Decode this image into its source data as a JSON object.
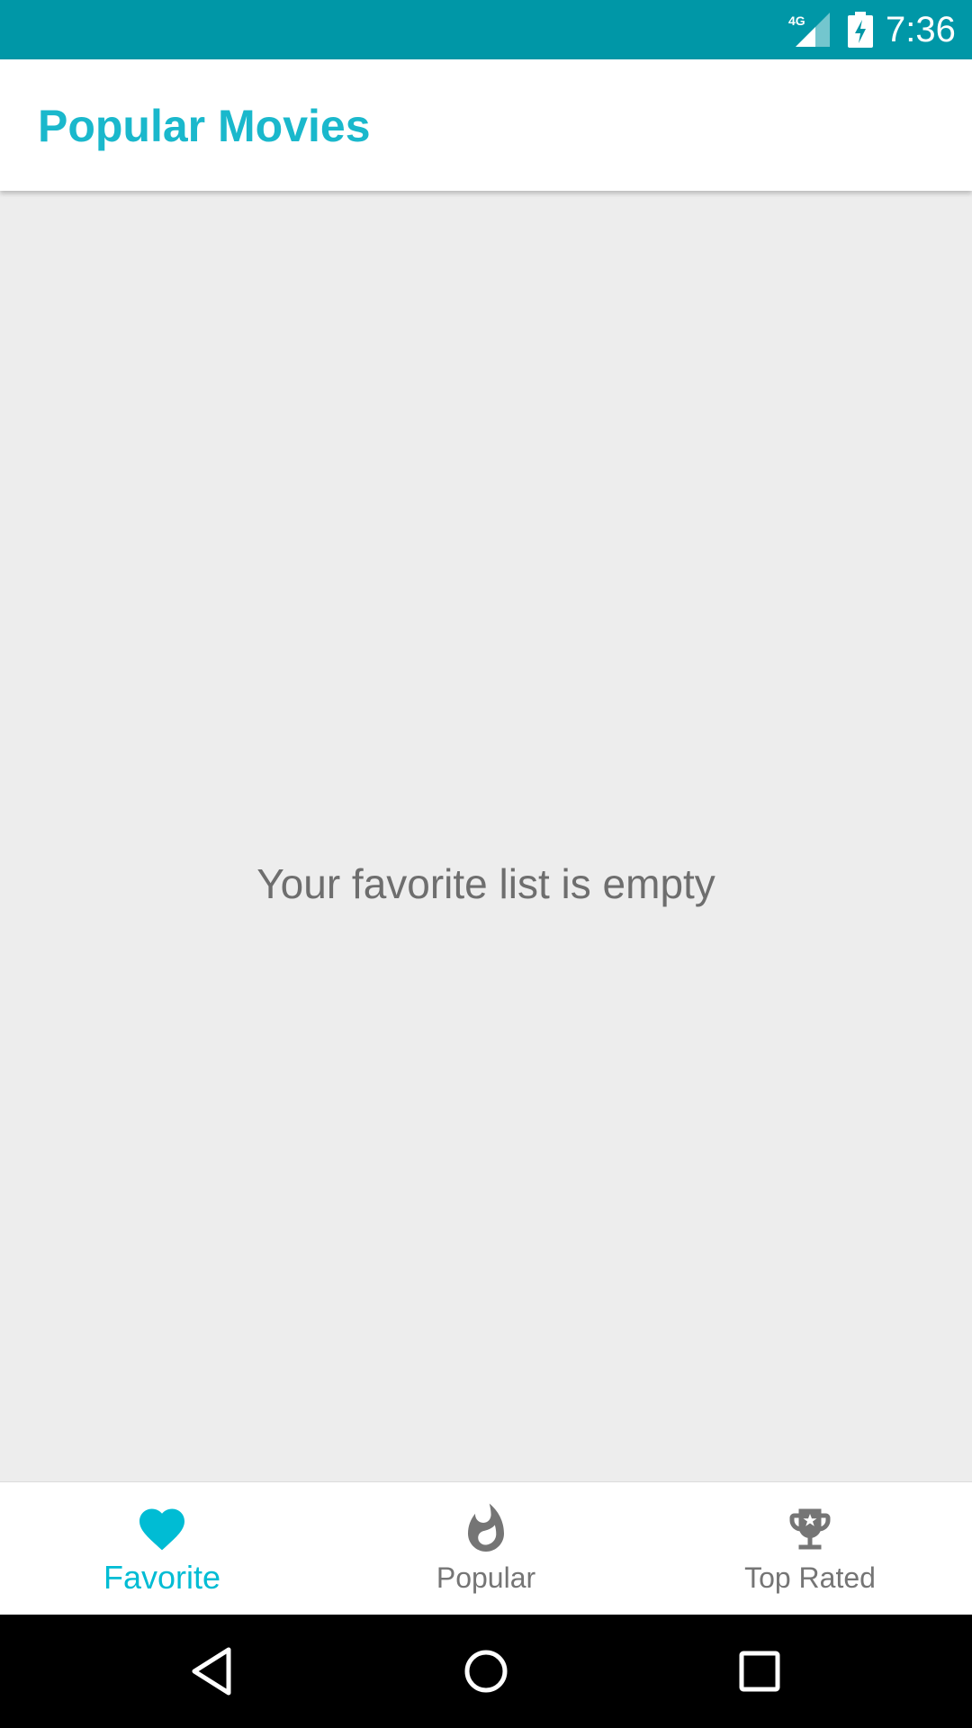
{
  "status_bar": {
    "time": "7:36",
    "network_label": "4G",
    "background_color": "#0097a7",
    "icons": [
      "signal-4g-icon",
      "battery-charging-icon"
    ]
  },
  "app_bar": {
    "title": "Popular Movies",
    "title_color": "#1ab8cc"
  },
  "content": {
    "empty_message": "Your favorite list is empty"
  },
  "bottom_nav": {
    "active_color": "#00bcd4",
    "inactive_color": "#757575",
    "items": [
      {
        "label": "Favorite",
        "icon": "heart-icon",
        "active": true
      },
      {
        "label": "Popular",
        "icon": "flame-icon",
        "active": false
      },
      {
        "label": "Top Rated",
        "icon": "trophy-icon",
        "active": false
      }
    ]
  },
  "system_nav": {
    "buttons": [
      "back-icon",
      "home-icon",
      "recents-icon"
    ]
  }
}
